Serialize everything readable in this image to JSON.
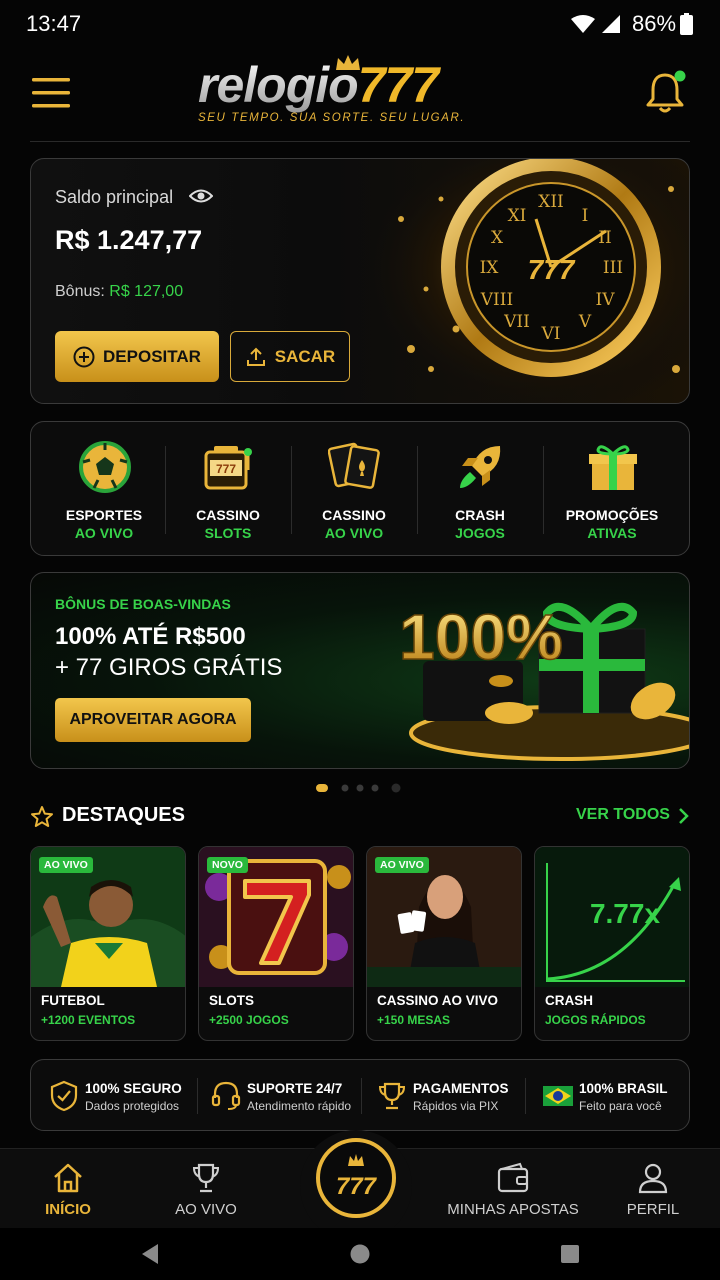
{
  "status_bar": {
    "time": "13:47",
    "battery": "86%"
  },
  "header": {
    "logo_text": "relogio777",
    "logo_tagline": "SEU TEMPO. SUA SORTE. SEU LUGAR."
  },
  "balance": {
    "label": "Saldo principal",
    "value": "R$ 1.247,77",
    "bonus_label": "Bônus:",
    "bonus_value": "R$ 127,00",
    "deposit_label": "DEPOSITAR",
    "withdraw_label": "SACAR"
  },
  "categories": [
    {
      "l1": "ESPORTES",
      "l2": "AO VIVO",
      "icon": "soccer-ball-icon"
    },
    {
      "l1": "CASSINO",
      "l2": "SLOTS",
      "icon": "slot-machine-icon"
    },
    {
      "l1": "CASSINO",
      "l2": "AO VIVO",
      "icon": "playing-cards-icon"
    },
    {
      "l1": "CRASH",
      "l2": "JOGOS",
      "icon": "rocket-icon"
    },
    {
      "l1": "PROMOÇÕES",
      "l2": "ATIVAS",
      "icon": "gift-icon"
    }
  ],
  "promo": {
    "eyebrow": "BÔNUS DE BOAS-VINDAS",
    "title1": "100% ATÉ R$500",
    "title2": "+ 77 GIROS GRÁTIS",
    "button": "APROVEITAR AGORA",
    "art_text": "100%"
  },
  "carousel": {
    "pages": 5,
    "active": 1
  },
  "highlights": {
    "title": "DESTAQUES",
    "see_all": "VER TODOS",
    "tiles": [
      {
        "badge": "AO VIVO",
        "title": "FUTEBOL",
        "sub": "+1200 EVENTOS"
      },
      {
        "badge": "NOVO",
        "title": "SLOTS",
        "sub": "+2500 JOGOS"
      },
      {
        "badge": "AO VIVO",
        "title": "CASSINO AO VIVO",
        "sub": "+150 MESAS"
      },
      {
        "badge": "",
        "title": "CRASH",
        "sub": "JOGOS RÁPIDOS",
        "art_text": "7.77x"
      }
    ]
  },
  "trust": [
    {
      "a": "100% SEGURO",
      "b": "Dados protegidos"
    },
    {
      "a": "SUPORTE 24/7",
      "b": "Atendimento rápido"
    },
    {
      "a": "PAGAMENTOS",
      "b": "Rápidos via PIX"
    },
    {
      "a": "100% BRASIL",
      "b": "Feito para você"
    }
  ],
  "nav": {
    "home": "INÍCIO",
    "live": "AO VIVO",
    "center": "777",
    "bets": "MINHAS APOSTAS",
    "profile": "PERFIL"
  },
  "colors": {
    "gold": "#e9b53a",
    "green": "#37d34a",
    "background": "#050505"
  }
}
